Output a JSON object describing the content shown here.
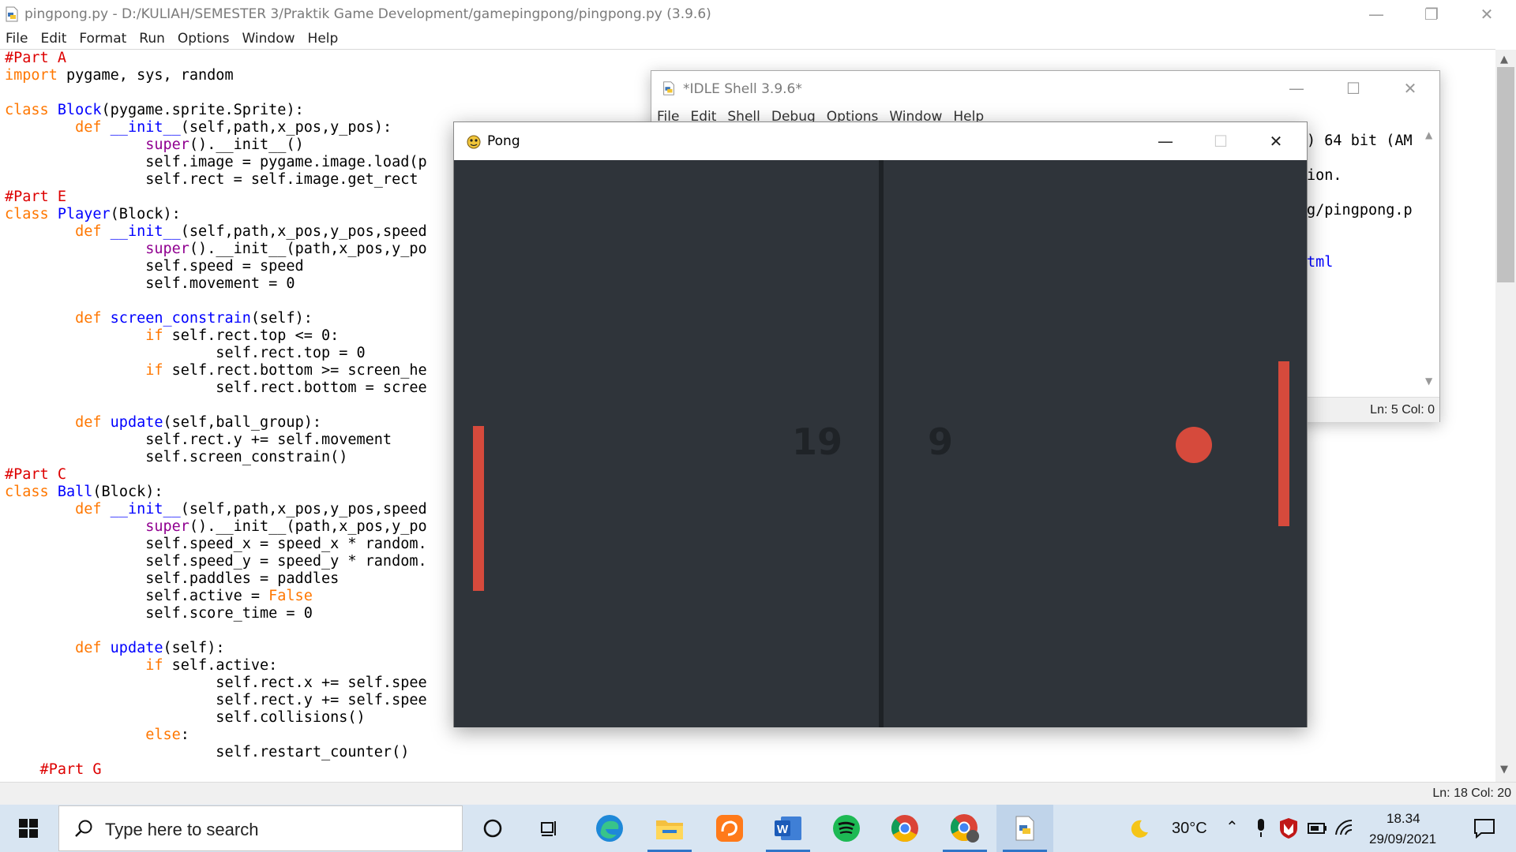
{
  "editor": {
    "title": "pingpong.py - D:/KULIAH/SEMESTER 3/Praktik Game Development/gamepingpong/pingpong.py (3.9.6)",
    "menu": [
      "File",
      "Edit",
      "Format",
      "Run",
      "Options",
      "Window",
      "Help"
    ],
    "status": "Ln: 18   Col: 20",
    "code_lines": [
      "#Part A",
      "import pygame, sys, random",
      "",
      "class Block(pygame.sprite.Sprite):",
      "        def __init__(self,path,x_pos,y_pos):",
      "                super().__init__()",
      "                self.image = pygame.image.load(p",
      "                self.rect = self.image.get_rect",
      "#Part E",
      "class Player(Block):",
      "        def __init__(self,path,x_pos,y_pos,speed",
      "                super().__init__(path,x_pos,y_po",
      "                self.speed = speed",
      "                self.movement = 0",
      "",
      "        def screen_constrain(self):",
      "                if self.rect.top <= 0:",
      "                        self.rect.top = 0",
      "                if self.rect.bottom >= screen_he",
      "                        self.rect.bottom = scree",
      "",
      "        def update(self,ball_group):",
      "                self.rect.y += self.movement",
      "                self.screen_constrain()",
      "#Part C",
      "class Ball(Block):",
      "        def __init__(self,path,x_pos,y_pos,speed",
      "                super().__init__(path,x_pos,y_po",
      "                self.speed_x = speed_x * random.",
      "                self.speed_y = speed_y * random.",
      "                self.paddles = paddles",
      "                self.active = False",
      "                self.score_time = 0",
      "",
      "        def update(self):",
      "                if self.active:",
      "                        self.rect.x += self.spee",
      "                        self.rect.y += self.spee",
      "                        self.collisions()",
      "                else:",
      "                        self.restart_counter()",
      "    #Part G"
    ]
  },
  "shell": {
    "title": "*IDLE Shell 3.9.6*",
    "menu": [
      "File",
      "Edit",
      "Shell",
      "Debug",
      "Options",
      "Window",
      "Help"
    ],
    "lines": [
      ") 64 bit (AM",
      "ion.",
      "g/pingpong.p",
      "",
      "tml"
    ],
    "status": "Ln: 5   Col: 0"
  },
  "pong": {
    "title": "Pong",
    "score_left": "19",
    "score_right": "9",
    "colors": {
      "background": "#2f343a",
      "paddle": "#d64a3c",
      "ball": "#d64a3c",
      "score": "#1f2327"
    }
  },
  "taskbar": {
    "search_placeholder": "Type here to search",
    "weather_temp": "30°C",
    "time": "18.34",
    "date": "29/09/2021",
    "icons": [
      "cortana-icon",
      "task-view-icon",
      "edge-icon",
      "file-explorer-icon",
      "uc-browser-icon",
      "word-icon",
      "spotify-icon",
      "chrome-icon",
      "chrome-profile-icon",
      "python-idle-icon"
    ]
  }
}
